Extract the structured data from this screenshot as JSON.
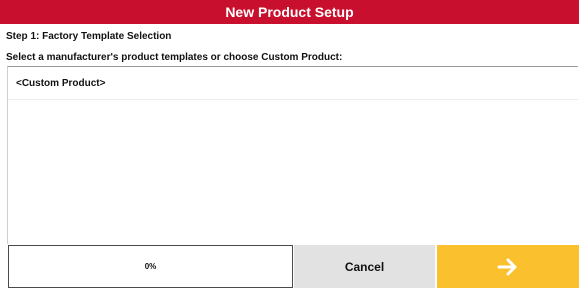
{
  "window": {
    "title": "New Product Setup"
  },
  "step": {
    "label": "Step 1: Factory Template Selection"
  },
  "instruction": "Select a manufacturer's product templates or choose Custom Product:",
  "templates": [
    {
      "label": "<Custom Product>"
    }
  ],
  "footer": {
    "progress_text": "0%",
    "progress_value": 0,
    "cancel_label": "Cancel",
    "next_icon": "arrow-right-icon"
  },
  "colors": {
    "title_bar": "#c8102e",
    "next_button": "#fbc02d",
    "cancel_button": "#e2e2e2"
  }
}
